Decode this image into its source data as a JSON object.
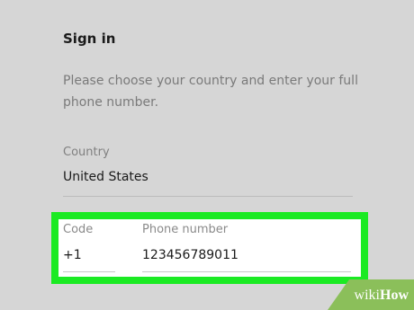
{
  "signin": {
    "title": "Sign in",
    "subtitle": "Please choose your country and enter your full phone number."
  },
  "country": {
    "label": "Country",
    "value": "United States"
  },
  "code": {
    "label": "Code",
    "value": "+1"
  },
  "phone": {
    "label": "Phone number",
    "value": "123456789011"
  },
  "highlight": {
    "color": "#1bea23"
  },
  "watermark": {
    "prefix": "wiki",
    "brand": "How"
  }
}
